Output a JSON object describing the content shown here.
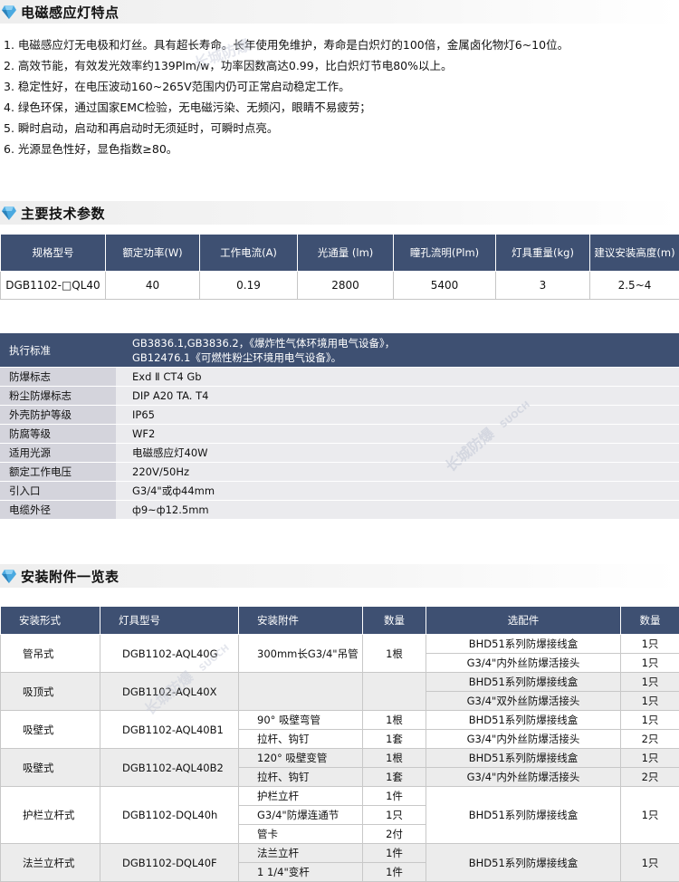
{
  "sections": {
    "features_title": "电磁感应灯特点",
    "params_title": "主要技术参数",
    "accessories_title": "安装附件一览表"
  },
  "features": [
    "1. 电磁感应灯无电极和灯丝。具有超长寿命。长年使用免维护，寿命是白炽灯的100倍，金属卤化物灯6~10位。",
    "2. 高效节能，有效发光效率约139Plm/w，功率因数高达0.99，比白炽灯节电80%以上。",
    "3. 稳定性好，在电压波动160~265V范围内仍可正常启动稳定工作。",
    "4. 绿色环保，通过国家EMC检验，无电磁污染、无频闪，眼睛不易疲劳；",
    "5. 瞬时启动，启动和再启动时无须延时，可瞬时点亮。",
    "6. 光源显色性好，显色指数≥80。"
  ],
  "params_table": {
    "headers": [
      "规格型号",
      "额定功率(W)",
      "工作电流(A)",
      "光通量 (lm)",
      "瞳孔流明(Plm)",
      "灯具重量(kg)",
      "建议安装高度(m)"
    ],
    "row": [
      "DGB1102-□QL40",
      "40",
      "0.19",
      "2800",
      "5400",
      "3",
      "2.5~4"
    ]
  },
  "specs": {
    "header_label": "执行标准",
    "header_value_1": "GB3836.1,GB3836.2，《爆炸性气体环境用电气设备》，",
    "header_value_2": "GB12476.1《可燃性粉尘环境用电气设备》。",
    "rows": [
      {
        "label": "防爆标志",
        "value": "Exd Ⅱ CT4  Gb"
      },
      {
        "label": "粉尘防爆标志",
        "value": "DIP A20 TA. T4"
      },
      {
        "label": "外壳防护等级",
        "value": "IP65"
      },
      {
        "label": "防腐等级",
        "value": "WF2"
      },
      {
        "label": "适用光源",
        "value": "电磁感应灯40W"
      },
      {
        "label": "额定工作电压",
        "value": "220V/50Hz"
      },
      {
        "label": "引入口",
        "value": "G3/4\"或ф44mm"
      },
      {
        "label": "电缆外径",
        "value": "ф9~ф12.5mm"
      }
    ]
  },
  "acc_table": {
    "headers": [
      "安装形式",
      "灯具型号",
      "安装附件",
      "数量",
      "选配件",
      "数量"
    ],
    "groups": [
      {
        "form": "管吊式",
        "model": "DGB1102-AQL40G",
        "fittings": [
          {
            "name": "300mm长G3/4\"吊管",
            "qty": "1根"
          }
        ],
        "options": [
          {
            "name": "BHD51系列防爆接线盒",
            "qty": "1只"
          },
          {
            "name": "G3/4\"内外丝防爆活接头",
            "qty": "1只"
          }
        ]
      },
      {
        "form": "吸顶式",
        "model": "DGB1102-AQL40X",
        "fittings": [],
        "options": [
          {
            "name": "BHD51系列防爆接线盒",
            "qty": "1只"
          },
          {
            "name": "G3/4\"双外丝防爆活接头",
            "qty": "1只"
          }
        ]
      },
      {
        "form": "吸壁式",
        "model": "DGB1102-AQL40B1",
        "fittings": [
          {
            "name": "90°  吸壁弯管",
            "qty": "1根"
          },
          {
            "name": "拉杆、钩钉",
            "qty": "1套"
          }
        ],
        "options": [
          {
            "name": "BHD51系列防爆接线盒",
            "qty": "1只"
          },
          {
            "name": "G3/4\"内外丝防爆活接头",
            "qty": "2只"
          }
        ]
      },
      {
        "form": "吸壁式",
        "model": "DGB1102-AQL40B2",
        "fittings": [
          {
            "name": "120°  吸壁变管",
            "qty": "1根"
          },
          {
            "name": "拉杆、钩钉",
            "qty": "1套"
          }
        ],
        "options": [
          {
            "name": "BHD51系列防爆接线盒",
            "qty": "1只"
          },
          {
            "name": "G3/4\"内外丝防爆活接头",
            "qty": "2只"
          }
        ]
      },
      {
        "form": "护栏立杆式",
        "model": "DGB1102-DQL40h",
        "fittings": [
          {
            "name": "护栏立杆",
            "qty": "1件"
          },
          {
            "name": "G3/4\"防爆连通节",
            "qty": "1只"
          },
          {
            "name": "管卡",
            "qty": "2付"
          }
        ],
        "options": [
          {
            "name": "BHD51系列防爆接线盒",
            "qty": "1只"
          }
        ]
      },
      {
        "form": "法兰立杆式",
        "model": "DGB1102-DQL40F",
        "fittings": [
          {
            "name": "法兰立杆",
            "qty": "1件"
          },
          {
            "name": "1 1/4\"变杆",
            "qty": "1件"
          }
        ],
        "options": [
          {
            "name": "BHD51系列防爆接线盒",
            "qty": "1只"
          }
        ]
      }
    ]
  },
  "watermark": {
    "text": "长城防爆",
    "sub": "SUOCH"
  },
  "colors": {
    "header_bg": "#3e5072",
    "label_bg": "#d4d4dc",
    "value_bg": "#ebebee",
    "gem": "#3aa0d8"
  }
}
